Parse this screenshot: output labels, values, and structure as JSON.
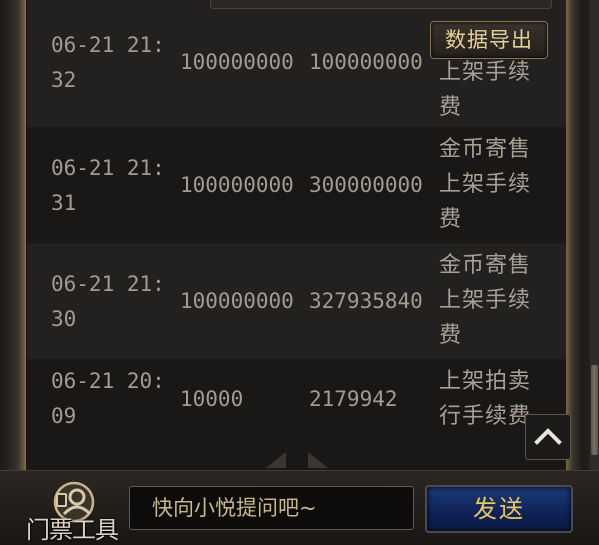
{
  "toolbar": {
    "export_label": "数据导出"
  },
  "rows": [
    {
      "time": "06-21 21:32",
      "amount": "100000000",
      "balance": "100000000",
      "type": "上架手续费",
      "type_top": ""
    },
    {
      "time": "06-21 21:31",
      "amount": "100000000",
      "balance": "300000000",
      "type": "金币寄售上架手续费"
    },
    {
      "time": "06-21 21:30",
      "amount": "100000000",
      "balance": "327935840",
      "type": "金币寄售上架手续费"
    },
    {
      "time": "06-21 20:09",
      "amount": "10000",
      "balance": "2179942",
      "type": "上架拍卖行手续费"
    }
  ],
  "chat": {
    "ticket_tool_label": "门票工具",
    "placeholder": "快向小悦提问吧~",
    "send_label": "发送"
  },
  "colors": {
    "accent_gold": "#e9c75a",
    "send_blue": "#0f2256",
    "frame_brown": "#8a744f"
  },
  "icons": {
    "scroll_up": "chevron-up-icon",
    "ticket": "ticket-person-icon",
    "pager": "arrow-left-right-icon"
  }
}
